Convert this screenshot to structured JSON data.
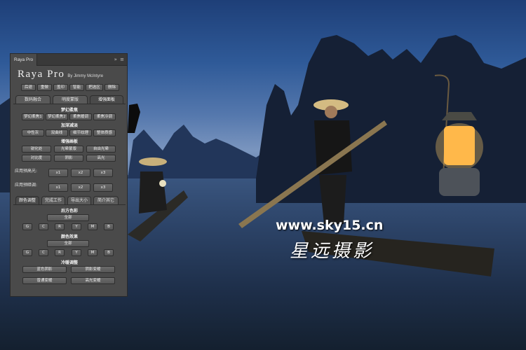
{
  "panel": {
    "tab_label": "Raya Pro",
    "controls": "»  ≡",
    "brand_name": "Raya Pro",
    "brand_by": "By Jimmy McIntyre",
    "toolbar": [
      "后退",
      "重做",
      "盖印",
      "智能",
      "把选区",
      "删除"
    ],
    "tabs_top": [
      "数码融合",
      "明度蒙版",
      "增强面板"
    ],
    "sections": {
      "dream": "梦幻柔焦",
      "add_texture": "加深减淡",
      "enhance": "增强画板",
      "color_lum": "后方色彩",
      "color_effects": "颜色效果",
      "cool_warm": "冷暖调整"
    },
    "dream_buttons": [
      "梦幻柔焦1",
      "梦幻柔焦2",
      "柔焦暖调",
      "柔焦冷调"
    ],
    "texture_buttons": [
      "中性灰",
      "双曲线",
      "细节纹理",
      "整体质感"
    ],
    "enhance_row1": [
      "锐化处",
      "光晕蒙版",
      "自由光晕"
    ],
    "enhance_row2": [
      "对比度",
      "阴影",
      "高光"
    ],
    "apply_glow_label": "应用预高光:",
    "apply_shadow_label": "应用预暗调:",
    "multipliers": [
      "x1",
      "x2",
      "x3"
    ],
    "tabs_bottom": [
      "颜色调整",
      "完成工作",
      "导出大小",
      "简介其它"
    ],
    "all_label": "全部",
    "channels": [
      "G",
      "C",
      "R",
      "Y",
      "M",
      "B"
    ],
    "cool_warm_buttons": [
      "蓝色阴影",
      "阴影变暖",
      "普通变暖",
      "高光变暖"
    ]
  },
  "watermark": {
    "url": "www.sky15.cn",
    "name_cn": "星远摄影"
  }
}
